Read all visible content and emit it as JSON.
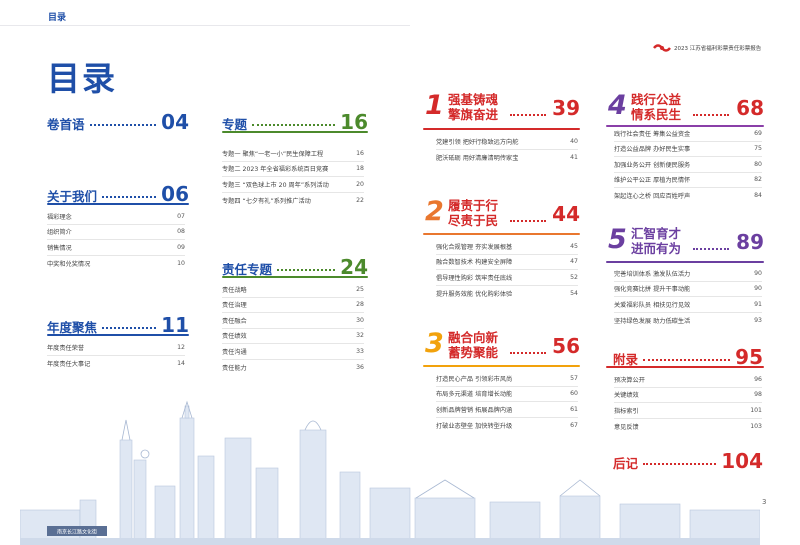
{
  "header": {
    "label": "目录",
    "report_title": "2023 江苏省福利彩票责任彩票报告"
  },
  "page_title": "目录",
  "colors": {
    "blue": "#1f4fa8",
    "green": "#4c8a2c",
    "red": "#d42a2a",
    "purple": "#6b3fa0"
  },
  "left_sections": [
    {
      "title": "卷首语",
      "page": "04",
      "items": []
    },
    {
      "title": "关于我们",
      "page": "06",
      "items": [
        {
          "label": "福彩理念",
          "page": "07"
        },
        {
          "label": "组织简介",
          "page": "08"
        },
        {
          "label": "销售情况",
          "page": "09"
        },
        {
          "label": "中奖和兑奖情况",
          "page": "10"
        }
      ]
    },
    {
      "title": "年度聚焦",
      "page": "11",
      "items": [
        {
          "label": "年度责任荣誉",
          "page": "12"
        },
        {
          "label": "年度责任大事记",
          "page": "14"
        }
      ]
    }
  ],
  "mid_sections": [
    {
      "title": "专题",
      "page": "16",
      "items": [
        {
          "label": "专题一 聚焦“一老一小”民生保障工程",
          "page": "16"
        },
        {
          "label": "专题二 2023 年全省福彩系统百日竞赛",
          "page": "18"
        },
        {
          "label": "专题三 “双色球上市 20 周年”系列活动",
          "page": "20"
        },
        {
          "label": "专题四 “七夕有礼”系列推广活动",
          "page": "22"
        }
      ]
    },
    {
      "title": "责任专题",
      "page": "24",
      "items": [
        {
          "label": "责任战略",
          "page": "25"
        },
        {
          "label": "责任治理",
          "page": "28"
        },
        {
          "label": "责任融合",
          "page": "30"
        },
        {
          "label": "责任绩效",
          "page": "32"
        },
        {
          "label": "责任沟通",
          "page": "33"
        },
        {
          "label": "责任能力",
          "page": "36"
        }
      ]
    }
  ],
  "right_sections": [
    {
      "num": "1",
      "line1": "强基铸魂",
      "line2": "擎旗奋进",
      "page": "39",
      "items": [
        {
          "label": "党建引领 把好行稳致远方向舵",
          "page": "40"
        },
        {
          "label": "肥沃砥砺 用好清廉清明传家宝",
          "page": "41"
        }
      ]
    },
    {
      "num": "2",
      "line1": "履责于行",
      "line2": "尽责于民",
      "page": "44",
      "items": [
        {
          "label": "强化合规管理 夯实发展根基",
          "page": "45"
        },
        {
          "label": "融合数智技术 构建安全屏障",
          "page": "47"
        },
        {
          "label": "倡导理性购彩 筑牢责任底线",
          "page": "52"
        },
        {
          "label": "提升服务效能 优化购彩体验",
          "page": "54"
        }
      ]
    },
    {
      "num": "3",
      "line1": "融合向新",
      "line2": "蓄势聚能",
      "page": "56",
      "items": [
        {
          "label": "打造民心产品 引领彩市风尚",
          "page": "57"
        },
        {
          "label": "布局多元渠道 培育增长动能",
          "page": "60"
        },
        {
          "label": "创新品牌营销 拓展品牌内涵",
          "page": "61"
        },
        {
          "label": "打破业态壁垒 加快转型升级",
          "page": "67"
        }
      ]
    },
    {
      "num": "4",
      "line1": "践行公益",
      "line2": "情系民生",
      "page": "68",
      "items": [
        {
          "label": "践行社会责任 筹集公益资金",
          "page": "69"
        },
        {
          "label": "打造公益品牌 办好民生实事",
          "page": "75"
        },
        {
          "label": "加强业务公开 创新便民服务",
          "page": "80"
        },
        {
          "label": "维护公平公正 厚植为民情怀",
          "page": "82"
        },
        {
          "label": "架起连心之桥 回应百姓呼声",
          "page": "84"
        }
      ]
    },
    {
      "num": "5",
      "line1": "汇智育才",
      "line2": "进而有为",
      "page": "89",
      "items": [
        {
          "label": "完善培训体系 激发队伍活力",
          "page": "90"
        },
        {
          "label": "强化竞赛比拼 提升干事动能",
          "page": "90"
        },
        {
          "label": "关爱福彩队员 相扶见行见效",
          "page": "91"
        },
        {
          "label": "坚持绿色发展 助力低碳生活",
          "page": "93"
        }
      ]
    },
    {
      "title": "附录",
      "page": "95",
      "items": [
        {
          "label": "预决算公开",
          "page": "96"
        },
        {
          "label": "关键绩效",
          "page": "98"
        },
        {
          "label": "指标索引",
          "page": "101"
        },
        {
          "label": "意见反馈",
          "page": "103"
        }
      ]
    },
    {
      "title": "后记",
      "page": "104",
      "items": []
    }
  ],
  "page_number": "3",
  "skyline_sign": "南京长江路文化街"
}
